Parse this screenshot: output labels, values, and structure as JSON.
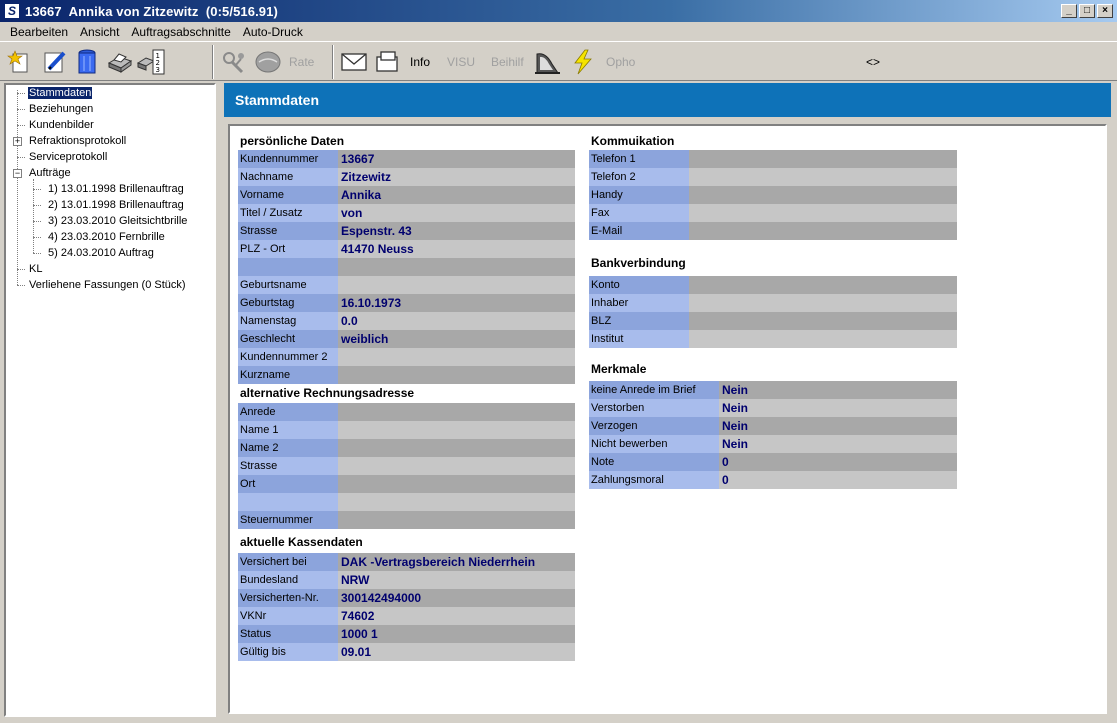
{
  "window": {
    "title": "13667  Annika von Zitzewitz  (0:5/516.91)",
    "app_icon_glyph": "S",
    "minimize_glyph": "_",
    "maximize_glyph": "□",
    "close_glyph": "×"
  },
  "menu": [
    "Bearbeiten",
    "Ansicht",
    "Auftragsabschnitte",
    "Auto-Druck"
  ],
  "toolbar": {
    "rate": "Rate",
    "info": "Info",
    "visu": "VISU",
    "beihilf": "Beihilf",
    "opho": "Opho",
    "nav": "<>"
  },
  "tree": {
    "stammdaten": "Stammdaten",
    "beziehungen": "Beziehungen",
    "kundenbilder": "Kundenbilder",
    "refraktionsprotokoll": "Refraktionsprotokoll",
    "serviceprotokoll": "Serviceprotokoll",
    "auftraege": "Aufträge",
    "order1": "1)  13.01.1998 Brillenauftrag",
    "order2": "2)  13.01.1998 Brillenauftrag",
    "order3": "3)  23.03.2010 Gleitsichtbrille",
    "order4": "4)  23.03.2010 Fernbrille",
    "order5": "5)  24.03.2010 Auftrag",
    "kl": "KL",
    "verliehene": "Verliehene Fassungen (0 Stück)",
    "expand_plus": "+",
    "expand_minus": "−"
  },
  "header": {
    "title": "Stammdaten"
  },
  "personal": {
    "title": "persönliche Daten",
    "rows": [
      {
        "label": "Kundennummer",
        "value": "13667"
      },
      {
        "label": "Nachname",
        "value": "Zitzewitz"
      },
      {
        "label": "Vorname",
        "value": "Annika"
      },
      {
        "label": "Titel / Zusatz",
        "value": "von"
      },
      {
        "label": "Strasse",
        "value": "Espenstr. 43"
      },
      {
        "label": "PLZ - Ort",
        "value": "41470 Neuss"
      },
      {
        "label": "",
        "value": ""
      },
      {
        "label": "Geburtsname",
        "value": ""
      },
      {
        "label": "Geburtstag",
        "value": "16.10.1973"
      },
      {
        "label": "Namenstag",
        "value": "0.0"
      },
      {
        "label": "Geschlecht",
        "value": "weiblich"
      },
      {
        "label": "Kundennummer 2",
        "value": ""
      },
      {
        "label": "Kurzname",
        "value": ""
      }
    ]
  },
  "alt_address": {
    "title": "alternative Rechnungsadresse",
    "rows": [
      {
        "label": "Anrede",
        "value": ""
      },
      {
        "label": "Name 1",
        "value": ""
      },
      {
        "label": "Name 2",
        "value": ""
      },
      {
        "label": "Strasse",
        "value": ""
      },
      {
        "label": "Ort",
        "value": ""
      },
      {
        "label": "",
        "value": ""
      },
      {
        "label": "Steuernummer",
        "value": ""
      }
    ]
  },
  "insurance": {
    "title": "aktuelle Kassendaten",
    "rows": [
      {
        "label": "Versichert bei",
        "value": "DAK -Vertragsbereich Niederrhein"
      },
      {
        "label": "Bundesland",
        "value": "NRW"
      },
      {
        "label": "Versicherten-Nr.",
        "value": "300142494000"
      },
      {
        "label": "VKNr",
        "value": "74602"
      },
      {
        "label": "Status",
        "value": "1000 1"
      },
      {
        "label": "Gültig bis",
        "value": "09.01"
      }
    ]
  },
  "communication": {
    "title": "Kommuikation",
    "rows": [
      {
        "label": "Telefon 1",
        "value": ""
      },
      {
        "label": "Telefon 2",
        "value": ""
      },
      {
        "label": "Handy",
        "value": ""
      },
      {
        "label": "Fax",
        "value": ""
      },
      {
        "label": "E-Mail",
        "value": ""
      }
    ]
  },
  "bank": {
    "title": "Bankverbindung",
    "rows": [
      {
        "label": "Konto",
        "value": ""
      },
      {
        "label": "Inhaber",
        "value": ""
      },
      {
        "label": "BLZ",
        "value": ""
      },
      {
        "label": "Institut",
        "value": ""
      }
    ]
  },
  "features": {
    "title": "Merkmale",
    "rows": [
      {
        "label": "keine Anrede im Brief",
        "value": "Nein"
      },
      {
        "label": "Verstorben",
        "value": "Nein"
      },
      {
        "label": "Verzogen",
        "value": "Nein"
      },
      {
        "label": "Nicht bewerben",
        "value": "Nein"
      },
      {
        "label": "Note",
        "value": "0"
      },
      {
        "label": "Zahlungsmoral",
        "value": "0"
      }
    ]
  }
}
